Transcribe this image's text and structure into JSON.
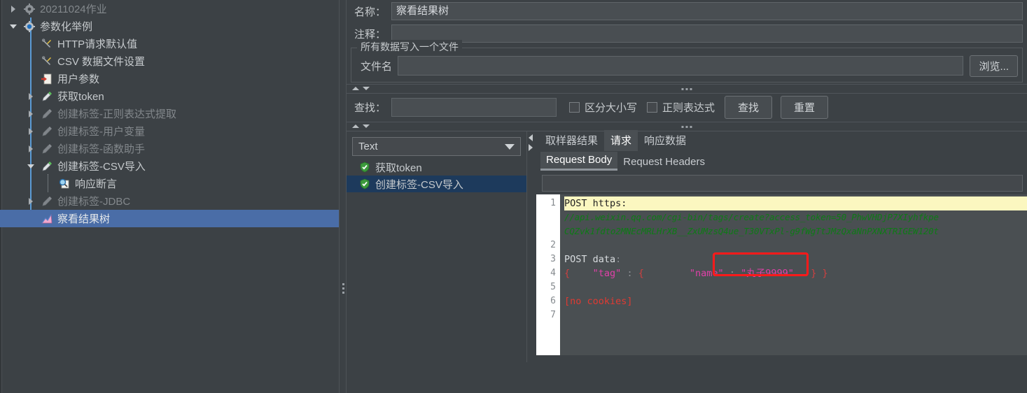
{
  "tree": {
    "items": [
      {
        "label": "20211024作业",
        "icon": "gear-icon",
        "indent": 0,
        "toggle": "collapsed",
        "dim": true,
        "selected": false
      },
      {
        "label": "参数化举例",
        "icon": "gear-blue-icon",
        "indent": 0,
        "toggle": "expanded",
        "dim": false,
        "selected": false
      },
      {
        "label": "HTTP请求默认值",
        "icon": "config-tools-icon",
        "indent": 1,
        "toggle": "none",
        "dim": false,
        "selected": false
      },
      {
        "label": "CSV 数据文件设置",
        "icon": "config-tools-icon",
        "indent": 1,
        "toggle": "none",
        "dim": false,
        "selected": false
      },
      {
        "label": "用户参数",
        "icon": "user-params-icon",
        "indent": 1,
        "toggle": "none",
        "dim": false,
        "selected": false
      },
      {
        "label": "获取token",
        "icon": "sampler-icon",
        "indent": 1,
        "toggle": "collapsed",
        "dim": false,
        "selected": false
      },
      {
        "label": "创建标签-正则表达式提取",
        "icon": "sampler-disabled-icon",
        "indent": 1,
        "toggle": "collapsed",
        "dim": true,
        "selected": false
      },
      {
        "label": "创建标签-用户变量",
        "icon": "sampler-disabled-icon",
        "indent": 1,
        "toggle": "collapsed",
        "dim": true,
        "selected": false
      },
      {
        "label": "创建标签-函数助手",
        "icon": "sampler-disabled-icon",
        "indent": 1,
        "toggle": "collapsed",
        "dim": true,
        "selected": false
      },
      {
        "label": "创建标签-CSV导入",
        "icon": "sampler-icon",
        "indent": 1,
        "toggle": "expanded",
        "dim": false,
        "selected": false
      },
      {
        "label": "响应断言",
        "icon": "assertion-icon",
        "indent": 2,
        "toggle": "line",
        "dim": false,
        "selected": false
      },
      {
        "label": "创建标签-JDBC",
        "icon": "sampler-disabled-icon",
        "indent": 1,
        "toggle": "collapsed",
        "dim": true,
        "selected": false
      },
      {
        "label": "察看结果树",
        "icon": "view-results-tree-icon",
        "indent": 1,
        "toggle": "none",
        "dim": false,
        "selected": true
      }
    ]
  },
  "form": {
    "name_label": "名称：",
    "name_value": "察看结果树",
    "comment_label": "注释：",
    "comment_value": "",
    "group_title": "所有数据写入一个文件",
    "filename_label": "文件名",
    "filename_value": "",
    "browse_button": "浏览..."
  },
  "search": {
    "label": "查找：",
    "value": "",
    "case_sensitive_label": "区分大小写",
    "case_sensitive_checked": false,
    "regex_label": "正则表达式",
    "regex_checked": false,
    "find_button": "查找",
    "reset_button": "重置"
  },
  "results": {
    "render_selector_value": "Text",
    "entries": [
      {
        "label": "获取token",
        "status": "success",
        "selected": false
      },
      {
        "label": "创建标签-CSV导入",
        "status": "success",
        "selected": true
      }
    ]
  },
  "detail": {
    "tabs": [
      {
        "label": "取样器结果",
        "active": false
      },
      {
        "label": "请求",
        "active": true
      },
      {
        "label": "响应数据",
        "active": false
      }
    ],
    "subtabs": [
      {
        "label": "Request Body",
        "active": true
      },
      {
        "label": "Request Headers",
        "active": false
      }
    ],
    "filter_value": "",
    "line_numbers": [
      "1",
      "2",
      "3",
      "4",
      "5",
      "6",
      "7"
    ],
    "code": {
      "line1_method": "POST https:",
      "line1_url_part1": "//api.weixin.qq.com/cgi-bin/tags/create?access_token=50_PhwVHDjP7XIyhfkpe",
      "line1_url_part2": "CQZvk1fdto2MNEcMRLHrXB__ZxUMzsQ4ue_T30VTxPl-g9fWgTtJMzQxaNnPXNXTRIGEW120t",
      "post_data_label": "POST data",
      "post_data_colon": ":",
      "body_brace_open": "{",
      "body_tag_key": "\"tag\"",
      "body_colon1": ":",
      "body_brace_open2": "{",
      "body_name_key": "\"name\"",
      "body_colon2": ":",
      "body_name_value": "\"丸子9999\"",
      "body_brace_close": "}",
      "body_brace_close2": "}",
      "cookies_line": "[no cookies]"
    }
  },
  "colors": {
    "background": "#3c4145",
    "selection_blue": "#4a6da7",
    "result_selection": "#1d3a5c",
    "highlight_yellow": "#fbf7c0",
    "url_green": "#0e7a16",
    "key_magenta": "#e040a8",
    "annotation_red": "#ff1a1a",
    "guide_blue": "#5b9bd5"
  }
}
